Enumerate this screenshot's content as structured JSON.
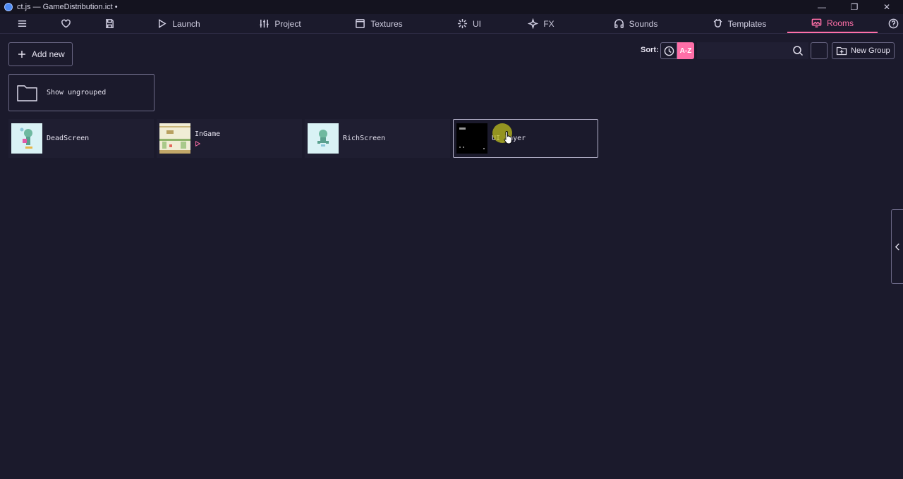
{
  "window": {
    "title": "ct.js — GameDistribution.ict •",
    "controls": [
      "—",
      "❐",
      "✕"
    ]
  },
  "nav": {
    "items": [
      {
        "label": "",
        "icon": "menu-icon"
      },
      {
        "label": "",
        "icon": "heart-icon"
      },
      {
        "label": "",
        "icon": "save-icon"
      },
      {
        "label": "Launch",
        "icon": "play-icon"
      },
      {
        "label": "Project",
        "icon": "sliders-icon"
      },
      {
        "label": "Textures",
        "icon": "image-icon"
      },
      {
        "label": "UI",
        "icon": "sparkle-icon"
      },
      {
        "label": "FX",
        "icon": "magic-icon"
      },
      {
        "label": "Sounds",
        "icon": "headphones-icon"
      },
      {
        "label": "Templates",
        "icon": "template-icon"
      },
      {
        "label": "Rooms",
        "icon": "room-icon",
        "active": true
      },
      {
        "label": "",
        "icon": "help-icon"
      }
    ],
    "accent_color": "#ff6fa8"
  },
  "toolbar": {
    "add_new_label": "Add new",
    "sort_label": "Sort:",
    "sort_az_label": "A-Z",
    "search_value": "",
    "new_group_label": "New Group"
  },
  "folders": {
    "ungrouped_label": "Show ungrouped"
  },
  "rooms": [
    {
      "name": "DeadScreen",
      "thumbnail": "light",
      "is_start": false
    },
    {
      "name": "InGame",
      "thumbnail": "light",
      "is_start": true
    },
    {
      "name": "RichScreen",
      "thumbnail": "light",
      "is_start": false
    },
    {
      "name": "UI_Layer",
      "thumbnail": "dark",
      "is_start": false,
      "selected": true
    }
  ]
}
